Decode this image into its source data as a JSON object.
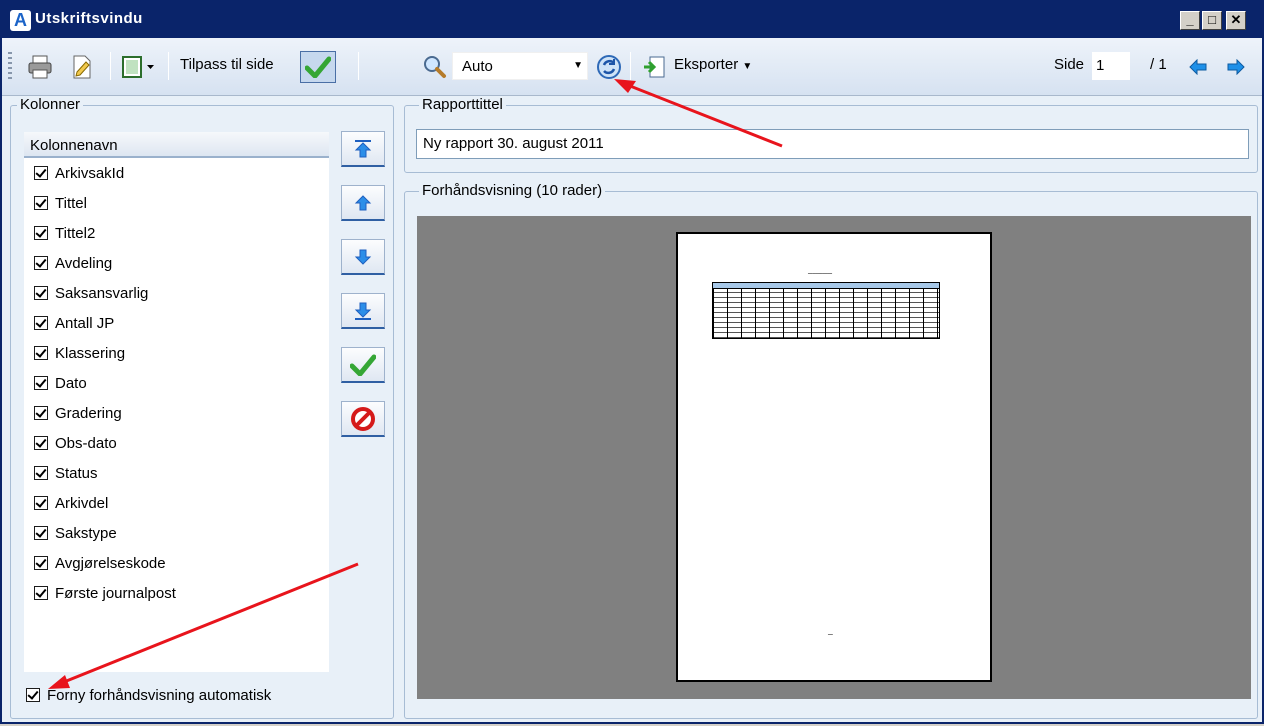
{
  "window": {
    "title": "Utskriftsvindu",
    "app_icon": "A"
  },
  "toolbar": {
    "fit_label": "Tilpass til side",
    "zoom_value": "Auto",
    "export_label": "Eksporter",
    "page_label": "Side",
    "page_value": "1",
    "page_total": "/ 1"
  },
  "columns_panel": {
    "title": "Kolonner",
    "header": "Kolonnenavn",
    "items": [
      {
        "label": "ArkivsakId",
        "checked": true
      },
      {
        "label": "Tittel",
        "checked": true
      },
      {
        "label": "Tittel2",
        "checked": true
      },
      {
        "label": "Avdeling",
        "checked": true
      },
      {
        "label": "Saksansvarlig",
        "checked": true
      },
      {
        "label": "Antall JP",
        "checked": true
      },
      {
        "label": "Klassering",
        "checked": true
      },
      {
        "label": "Dato",
        "checked": true
      },
      {
        "label": "Gradering",
        "checked": true
      },
      {
        "label": "Obs-dato",
        "checked": true
      },
      {
        "label": "Status",
        "checked": true
      },
      {
        "label": "Arkivdel",
        "checked": true
      },
      {
        "label": "Sakstype",
        "checked": true
      },
      {
        "label": "Avgjørelseskode",
        "checked": true
      },
      {
        "label": "Første journalpost",
        "checked": true
      }
    ],
    "auto_refresh_label": "Forny forhåndsvisning automatisk"
  },
  "report_title_panel": {
    "title": "Rapporttittel",
    "value": "Ny rapport 30. august 2011"
  },
  "preview_panel": {
    "title": "Forhåndsvisning (10 rader)"
  },
  "colors": {
    "titlebar": "#0a246a",
    "panel_bg": "#e8f0f8",
    "preview_bg": "#808080",
    "arrow": "#e8141c"
  }
}
